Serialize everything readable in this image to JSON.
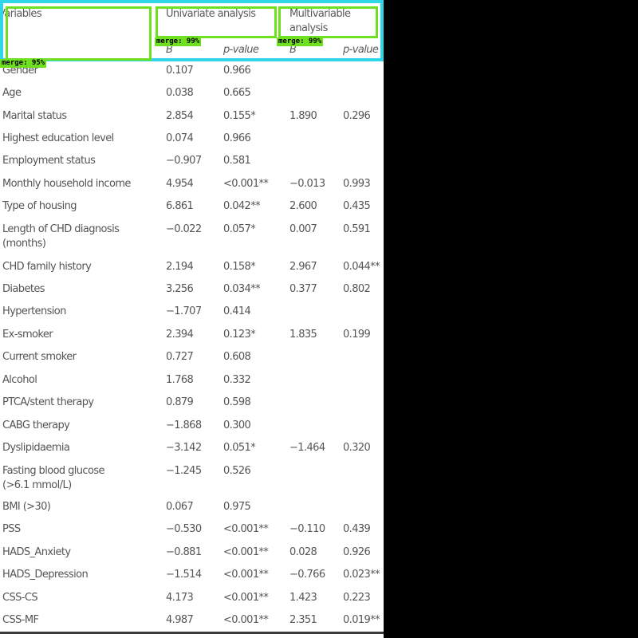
{
  "header": {
    "variables": "Variables",
    "univariate": "Univariate analysis",
    "multivariable_line1": "Multivariable",
    "multivariable_line2": "analysis",
    "b": "B",
    "p": "p-value"
  },
  "rows": [
    {
      "label": "Gender",
      "b1": "0.107",
      "p1": "0.966",
      "b2": "",
      "p2": ""
    },
    {
      "label": "Age",
      "b1": "0.038",
      "p1": "0.665",
      "b2": "",
      "p2": ""
    },
    {
      "label": "Marital status",
      "b1": "2.854",
      "p1": "0.155*",
      "b2": "1.890",
      "p2": "0.296"
    },
    {
      "label": "Highest education level",
      "b1": "0.074",
      "p1": "0.966",
      "b2": "",
      "p2": ""
    },
    {
      "label": "Employment status",
      "b1": "−0.907",
      "p1": "0.581",
      "b2": "",
      "p2": ""
    },
    {
      "label": "Monthly household income",
      "b1": "4.954",
      "p1": "<0.001**",
      "b2": "−0.013",
      "p2": "0.993"
    },
    {
      "label": "Type of housing",
      "b1": "6.861",
      "p1": "0.042**",
      "b2": "2.600",
      "p2": "0.435"
    },
    {
      "label": "Length of CHD diagnosis",
      "label2": "(months)",
      "b1": "−0.022",
      "p1": "0.057*",
      "b2": "0.007",
      "p2": "0.591"
    },
    {
      "label": "CHD family history",
      "b1": "2.194",
      "p1": "0.158*",
      "b2": "2.967",
      "p2": "0.044**"
    },
    {
      "label": "Diabetes",
      "b1": "3.256",
      "p1": "0.034**",
      "b2": "0.377",
      "p2": "0.802"
    },
    {
      "label": "Hypertension",
      "b1": "−1.707",
      "p1": "0.414",
      "b2": "",
      "p2": ""
    },
    {
      "label": "Ex-smoker",
      "b1": "2.394",
      "p1": "0.123*",
      "b2": "1.835",
      "p2": "0.199"
    },
    {
      "label": "Current smoker",
      "b1": "0.727",
      "p1": "0.608",
      "b2": "",
      "p2": ""
    },
    {
      "label": "Alcohol",
      "b1": "1.768",
      "p1": "0.332",
      "b2": "",
      "p2": ""
    },
    {
      "label": "PTCA/stent therapy",
      "b1": "0.879",
      "p1": "0.598",
      "b2": "",
      "p2": ""
    },
    {
      "label": "CABG therapy",
      "b1": "−1.868",
      "p1": "0.300",
      "b2": "",
      "p2": ""
    },
    {
      "label": "Dyslipidaemia",
      "b1": "−3.142",
      "p1": "0.051*",
      "b2": "−1.464",
      "p2": "0.320"
    },
    {
      "label": "Fasting blood glucose",
      "label2": "(>6.1 mmol/L)",
      "b1": "−1.245",
      "p1": "0.526",
      "b2": "",
      "p2": ""
    },
    {
      "label": "BMI (>30)",
      "b1": "0.067",
      "p1": "0.975",
      "b2": "",
      "p2": ""
    },
    {
      "label": "PSS",
      "b1": "−0.530",
      "p1": "<0.001**",
      "b2": "−0.110",
      "p2": "0.439"
    },
    {
      "label": "HADS_Anxiety",
      "b1": "−0.881",
      "p1": "<0.001**",
      "b2": "0.028",
      "p2": "0.926"
    },
    {
      "label": "HADS_Depression",
      "b1": "−1.514",
      "p1": "<0.001**",
      "b2": "−0.766",
      "p2": "0.023**"
    },
    {
      "label": "CSS-CS",
      "b1": "4.173",
      "p1": "<0.001**",
      "b2": "1.423",
      "p2": "0.223"
    },
    {
      "label": "CSS-MF",
      "b1": "4.987",
      "p1": "<0.001**",
      "b2": "2.351",
      "p2": "0.019**"
    }
  ],
  "overlay_tags": {
    "univariate": "merge: 99%",
    "multivariable": "merge: 99%",
    "variables": "merge: 95%"
  },
  "colors": {
    "text": "#555555",
    "annotation_green": "#6fe020",
    "annotation_cyan": "#2fd6e8",
    "background": "#000000"
  }
}
